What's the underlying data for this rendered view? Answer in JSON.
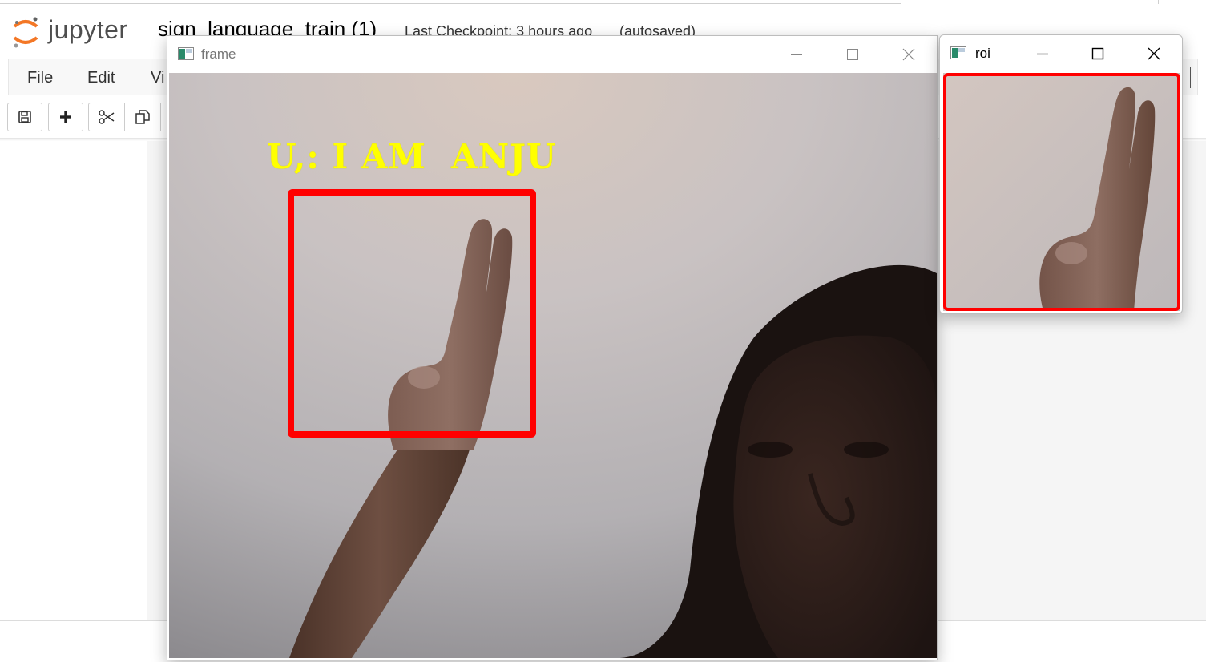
{
  "jupyter": {
    "logo_text": "jupyter",
    "notebook_name": "sign_language_train (1)",
    "checkpoint": "Last Checkpoint: 3 hours ago",
    "autosave_status": "(autosaved)",
    "menu": [
      "File",
      "Edit",
      "Vi"
    ],
    "toolbar": {
      "icons": [
        "save-icon",
        "plus-icon",
        "cut-icon",
        "copy-icon"
      ]
    }
  },
  "frame_window": {
    "title": "frame",
    "overlay_text": "U,: I AM  ANJU",
    "box_color": "#ff0000",
    "text_color": "#ffff00"
  },
  "roi_window": {
    "title": "roi",
    "border_color": "#ff0000"
  },
  "window_controls": [
    "minimize-icon",
    "maximize-icon",
    "close-icon"
  ]
}
